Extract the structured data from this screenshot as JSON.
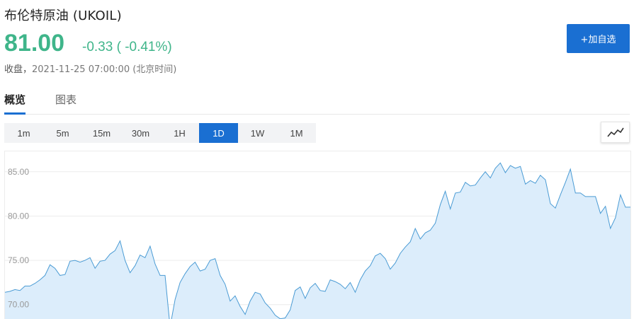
{
  "header": {
    "title": "布伦特原油 (UKOIL)",
    "price": "81.00",
    "change": "-0.33 ( -0.41%)",
    "status_label": "收盘，",
    "timestamp": "2021-11-25 07:00:00 (北京时间)",
    "price_color": "#3fb58a"
  },
  "actions": {
    "add_watchlist_label": "+加自选",
    "accent": "#1a6fd2"
  },
  "tabs": [
    {
      "label": "概览",
      "active": true
    },
    {
      "label": "图表",
      "active": false
    }
  ],
  "periods": [
    {
      "label": "1m",
      "active": false
    },
    {
      "label": "5m",
      "active": false
    },
    {
      "label": "15m",
      "active": false
    },
    {
      "label": "30m",
      "active": false
    },
    {
      "label": "1H",
      "active": false
    },
    {
      "label": "1D",
      "active": true
    },
    {
      "label": "1W",
      "active": false
    },
    {
      "label": "1M",
      "active": false
    }
  ],
  "chart_type_icon": "line-chart-icon",
  "chart_data": {
    "type": "area",
    "y_ticks": [
      "85.00",
      "80.00",
      "75.00",
      "70.00"
    ],
    "y_tick_values": [
      85,
      80,
      75,
      70
    ],
    "ylim": [
      68.3,
      87.3
    ],
    "grid": true,
    "line_color": "#4a9bd4",
    "fill_color": "#dcedfb",
    "values": [
      71.4,
      71.5,
      71.7,
      71.6,
      72.1,
      72.1,
      72.4,
      72.8,
      73.3,
      74.5,
      74.1,
      73.3,
      73.4,
      74.9,
      75.0,
      74.8,
      75.0,
      75.3,
      74.1,
      74.9,
      75.0,
      75.7,
      76.1,
      77.2,
      75.0,
      73.6,
      74.4,
      75.6,
      75.3,
      76.6,
      74.6,
      73.3,
      73.3,
      67.5,
      70.6,
      72.5,
      73.5,
      74.3,
      74.8,
      73.8,
      74.0,
      75.0,
      75.2,
      73.3,
      72.3,
      70.4,
      71.0,
      69.8,
      68.9,
      70.4,
      71.4,
      71.2,
      70.2,
      69.6,
      68.8,
      68.4,
      68.5,
      69.4,
      71.6,
      72.0,
      70.7,
      71.9,
      72.4,
      71.6,
      71.5,
      72.8,
      72.6,
      72.3,
      71.8,
      72.5,
      71.4,
      72.8,
      73.8,
      74.4,
      75.5,
      75.8,
      75.2,
      74.0,
      74.7,
      75.8,
      76.5,
      77.1,
      78.6,
      77.4,
      78.1,
      78.4,
      79.2,
      81.3,
      82.8,
      80.8,
      82.6,
      82.7,
      83.8,
      83.4,
      83.5,
      84.3,
      85.0,
      84.3,
      85.4,
      86.0,
      84.9,
      85.7,
      85.4,
      85.6,
      83.6,
      84.0,
      83.7,
      84.6,
      84.1,
      81.4,
      80.9,
      82.4,
      83.8,
      85.3,
      82.6,
      82.6,
      82.2,
      82.2,
      82.2,
      80.3,
      81.1,
      78.6,
      79.8,
      82.4,
      81.0,
      81.0
    ]
  }
}
